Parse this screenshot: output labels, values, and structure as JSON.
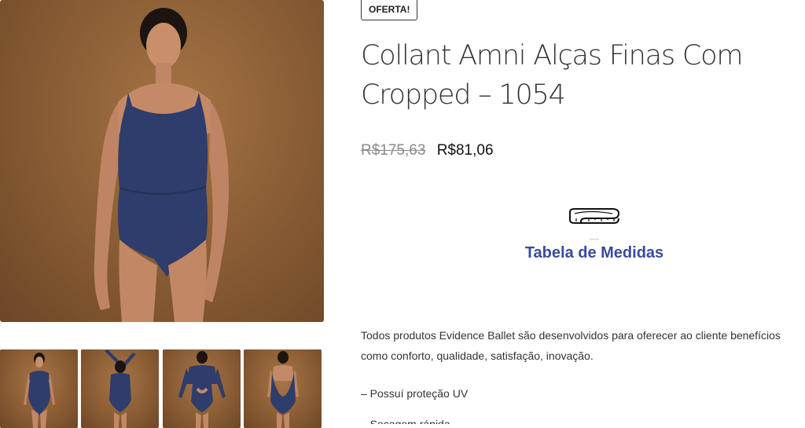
{
  "gallery": {
    "main_alt": "Collant Amni Alças Finas Com Cropped – 1054",
    "thumbnails": [
      "front",
      "back-arms-up",
      "back-cropped",
      "back"
    ]
  },
  "product": {
    "badge": "OFERTA!",
    "title": "Collant Amni Alças Finas Com Cropped – 1054",
    "price_old": "R$175,63",
    "price_new": "R$81,06"
  },
  "size_chart": {
    "icon": "measuring-tape-icon",
    "label": "Tabela de Medidas",
    "color": "#3b4a9e"
  },
  "description": {
    "paragraph_1": "Todos produtos Evidence Ballet são desenvolvidos para oferecer ao cliente benefícios como conforto, qualidade, satisfação, inovação.",
    "paragraph_2": "– Possuí proteção UV",
    "paragraph_3": "– Secagem rápida"
  },
  "colors": {
    "background": "#ffffff",
    "leotard": "#2e3d6b",
    "photo_bg": "#8c5f36"
  }
}
